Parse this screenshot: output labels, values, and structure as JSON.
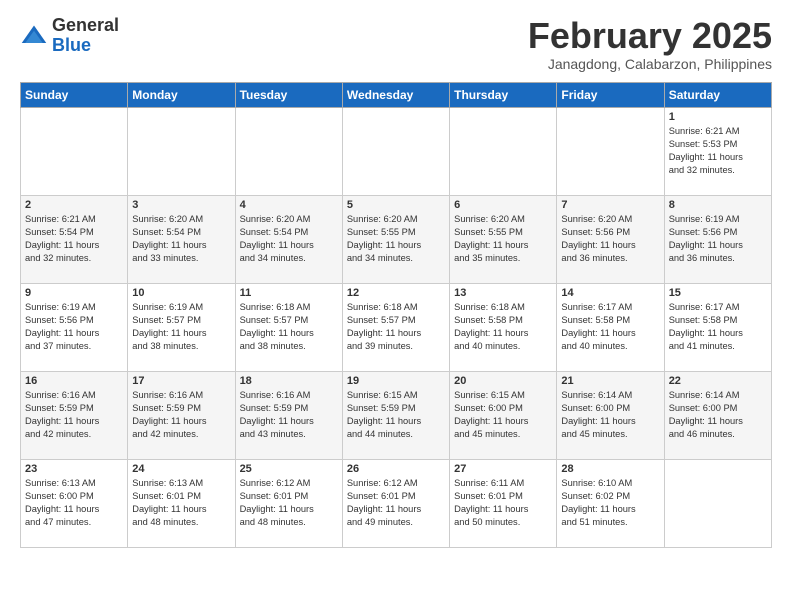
{
  "logo": {
    "general": "General",
    "blue": "Blue"
  },
  "header": {
    "month_year": "February 2025",
    "location": "Janagdong, Calabarzon, Philippines"
  },
  "weekdays": [
    "Sunday",
    "Monday",
    "Tuesday",
    "Wednesday",
    "Thursday",
    "Friday",
    "Saturday"
  ],
  "weeks": [
    [
      {
        "day": "",
        "info": ""
      },
      {
        "day": "",
        "info": ""
      },
      {
        "day": "",
        "info": ""
      },
      {
        "day": "",
        "info": ""
      },
      {
        "day": "",
        "info": ""
      },
      {
        "day": "",
        "info": ""
      },
      {
        "day": "1",
        "info": "Sunrise: 6:21 AM\nSunset: 5:53 PM\nDaylight: 11 hours\nand 32 minutes."
      }
    ],
    [
      {
        "day": "2",
        "info": "Sunrise: 6:21 AM\nSunset: 5:54 PM\nDaylight: 11 hours\nand 32 minutes."
      },
      {
        "day": "3",
        "info": "Sunrise: 6:20 AM\nSunset: 5:54 PM\nDaylight: 11 hours\nand 33 minutes."
      },
      {
        "day": "4",
        "info": "Sunrise: 6:20 AM\nSunset: 5:54 PM\nDaylight: 11 hours\nand 34 minutes."
      },
      {
        "day": "5",
        "info": "Sunrise: 6:20 AM\nSunset: 5:55 PM\nDaylight: 11 hours\nand 34 minutes."
      },
      {
        "day": "6",
        "info": "Sunrise: 6:20 AM\nSunset: 5:55 PM\nDaylight: 11 hours\nand 35 minutes."
      },
      {
        "day": "7",
        "info": "Sunrise: 6:20 AM\nSunset: 5:56 PM\nDaylight: 11 hours\nand 36 minutes."
      },
      {
        "day": "8",
        "info": "Sunrise: 6:19 AM\nSunset: 5:56 PM\nDaylight: 11 hours\nand 36 minutes."
      }
    ],
    [
      {
        "day": "9",
        "info": "Sunrise: 6:19 AM\nSunset: 5:56 PM\nDaylight: 11 hours\nand 37 minutes."
      },
      {
        "day": "10",
        "info": "Sunrise: 6:19 AM\nSunset: 5:57 PM\nDaylight: 11 hours\nand 38 minutes."
      },
      {
        "day": "11",
        "info": "Sunrise: 6:18 AM\nSunset: 5:57 PM\nDaylight: 11 hours\nand 38 minutes."
      },
      {
        "day": "12",
        "info": "Sunrise: 6:18 AM\nSunset: 5:57 PM\nDaylight: 11 hours\nand 39 minutes."
      },
      {
        "day": "13",
        "info": "Sunrise: 6:18 AM\nSunset: 5:58 PM\nDaylight: 11 hours\nand 40 minutes."
      },
      {
        "day": "14",
        "info": "Sunrise: 6:17 AM\nSunset: 5:58 PM\nDaylight: 11 hours\nand 40 minutes."
      },
      {
        "day": "15",
        "info": "Sunrise: 6:17 AM\nSunset: 5:58 PM\nDaylight: 11 hours\nand 41 minutes."
      }
    ],
    [
      {
        "day": "16",
        "info": "Sunrise: 6:16 AM\nSunset: 5:59 PM\nDaylight: 11 hours\nand 42 minutes."
      },
      {
        "day": "17",
        "info": "Sunrise: 6:16 AM\nSunset: 5:59 PM\nDaylight: 11 hours\nand 42 minutes."
      },
      {
        "day": "18",
        "info": "Sunrise: 6:16 AM\nSunset: 5:59 PM\nDaylight: 11 hours\nand 43 minutes."
      },
      {
        "day": "19",
        "info": "Sunrise: 6:15 AM\nSunset: 5:59 PM\nDaylight: 11 hours\nand 44 minutes."
      },
      {
        "day": "20",
        "info": "Sunrise: 6:15 AM\nSunset: 6:00 PM\nDaylight: 11 hours\nand 45 minutes."
      },
      {
        "day": "21",
        "info": "Sunrise: 6:14 AM\nSunset: 6:00 PM\nDaylight: 11 hours\nand 45 minutes."
      },
      {
        "day": "22",
        "info": "Sunrise: 6:14 AM\nSunset: 6:00 PM\nDaylight: 11 hours\nand 46 minutes."
      }
    ],
    [
      {
        "day": "23",
        "info": "Sunrise: 6:13 AM\nSunset: 6:00 PM\nDaylight: 11 hours\nand 47 minutes."
      },
      {
        "day": "24",
        "info": "Sunrise: 6:13 AM\nSunset: 6:01 PM\nDaylight: 11 hours\nand 48 minutes."
      },
      {
        "day": "25",
        "info": "Sunrise: 6:12 AM\nSunset: 6:01 PM\nDaylight: 11 hours\nand 48 minutes."
      },
      {
        "day": "26",
        "info": "Sunrise: 6:12 AM\nSunset: 6:01 PM\nDaylight: 11 hours\nand 49 minutes."
      },
      {
        "day": "27",
        "info": "Sunrise: 6:11 AM\nSunset: 6:01 PM\nDaylight: 11 hours\nand 50 minutes."
      },
      {
        "day": "28",
        "info": "Sunrise: 6:10 AM\nSunset: 6:02 PM\nDaylight: 11 hours\nand 51 minutes."
      },
      {
        "day": "",
        "info": ""
      }
    ]
  ]
}
